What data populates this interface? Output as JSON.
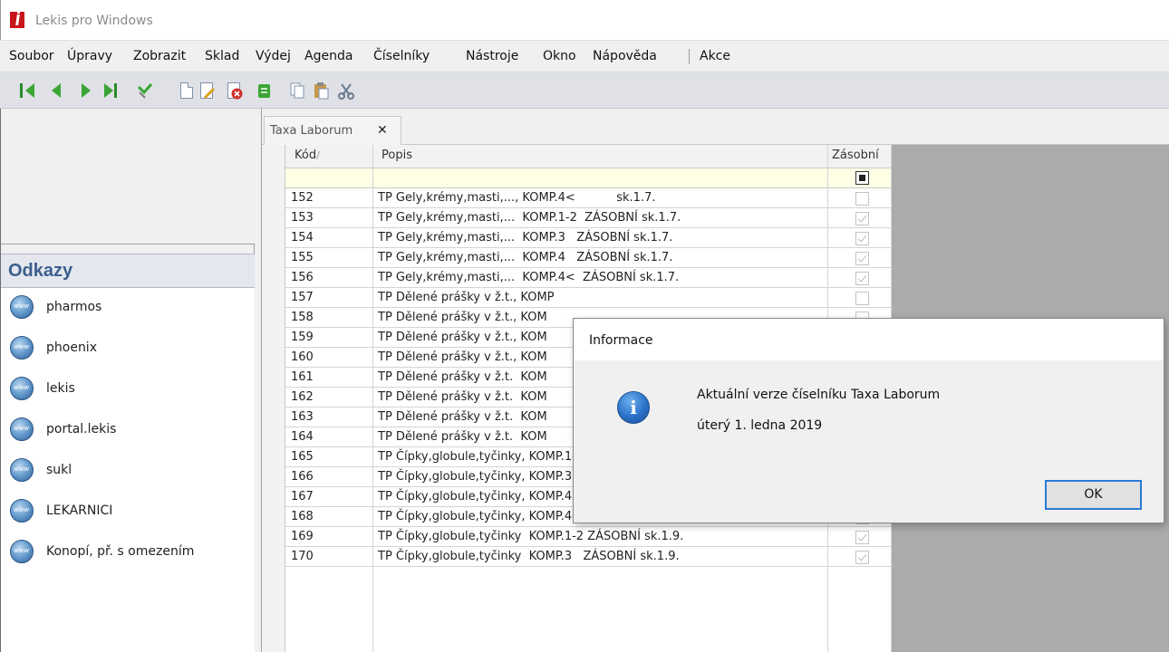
{
  "window": {
    "title": "Lekis pro Windows"
  },
  "menu": [
    "Soubor",
    "Úpravy",
    "Zobrazit",
    "Sklad",
    "Výdej",
    "Agenda",
    "Číselníky",
    "Nástroje",
    "Okno",
    "Nápověda",
    "Akce"
  ],
  "toolbar": {
    "icons": [
      "first-record-icon",
      "previous-record-icon",
      "next-record-icon",
      "last-record-icon",
      "filter-icon",
      "new-document-icon",
      "edit-document-icon",
      "delete-document-icon",
      "refresh-icon",
      "copy-icon",
      "paste-icon",
      "cut-icon"
    ]
  },
  "sidebar": {
    "links_title": "Odkazy",
    "links": [
      {
        "label": "pharmos",
        "icon": "globe-icon"
      },
      {
        "label": "phoenix",
        "icon": "globe-icon"
      },
      {
        "label": "lekis",
        "icon": "globe-icon"
      },
      {
        "label": "portal.lekis",
        "icon": "globe-icon"
      },
      {
        "label": "sukl",
        "icon": "globe-icon"
      },
      {
        "label": "LEKARNICI",
        "icon": "globe-icon"
      },
      {
        "label": "Konopí,  př. s omezením",
        "icon": "globe-icon"
      }
    ]
  },
  "tab": {
    "label": "Taxa Laborum",
    "close": "✕"
  },
  "grid": {
    "columns": {
      "kod": "Kód",
      "sort_marker": "/",
      "popis": "Popis",
      "zasobni": "Zásobní"
    },
    "rows": [
      {
        "kod": "152",
        "popis": "TP Gely,krémy,masti,..., KOMP.4<           sk.1.7.",
        "checked": false
      },
      {
        "kod": "153",
        "popis": "TP Gely,krémy,masti,...  KOMP.1-2  ZÁSOBNÍ sk.1.7.",
        "checked": true
      },
      {
        "kod": "154",
        "popis": "TP Gely,krémy,masti,...  KOMP.3   ZÁSOBNÍ sk.1.7.",
        "checked": true
      },
      {
        "kod": "155",
        "popis": "TP Gely,krémy,masti,...  KOMP.4   ZÁSOBNÍ sk.1.7.",
        "checked": true
      },
      {
        "kod": "156",
        "popis": "TP Gely,krémy,masti,...  KOMP.4<  ZÁSOBNÍ sk.1.7.",
        "checked": true
      },
      {
        "kod": "157",
        "popis": "TP Dělené prášky v ž.t., KOMP",
        "checked": false
      },
      {
        "kod": "158",
        "popis": "TP Dělené prášky v ž.t., KOM",
        "checked": false
      },
      {
        "kod": "159",
        "popis": "TP Dělené prášky v ž.t., KOM",
        "checked": false
      },
      {
        "kod": "160",
        "popis": "TP Dělené prášky v ž.t., KOM",
        "checked": false
      },
      {
        "kod": "161",
        "popis": "TP Dělené prášky v ž.t.  KOM",
        "checked": false
      },
      {
        "kod": "162",
        "popis": "TP Dělené prášky v ž.t.  KOM",
        "checked": false
      },
      {
        "kod": "163",
        "popis": "TP Dělené prášky v ž.t.  KOM",
        "checked": false
      },
      {
        "kod": "164",
        "popis": "TP Dělené prášky v ž.t.  KOM",
        "checked": false
      },
      {
        "kod": "165",
        "popis": "TP Čípky,globule,tyčinky, KOMP.1-2          sk.1.9.",
        "checked": false
      },
      {
        "kod": "166",
        "popis": "TP Čípky,globule,tyčinky, KOMP.3           sk.1.9.",
        "checked": false
      },
      {
        "kod": "167",
        "popis": "TP Čípky,globule,tyčinky, KOMP.4           sk.1.9.",
        "checked": false
      },
      {
        "kod": "168",
        "popis": "TP Čípky,globule,tyčinky, KOMP.4<           sk.1.9.",
        "checked": false
      },
      {
        "kod": "169",
        "popis": "TP Čípky,globule,tyčinky  KOMP.1-2 ZÁSOBNÍ sk.1.9.",
        "checked": true
      },
      {
        "kod": "170",
        "popis": "TP Čípky,globule,tyčinky  KOMP.3   ZÁSOBNÍ sk.1.9.",
        "checked": true
      }
    ]
  },
  "dialog": {
    "title": "Informace",
    "message": "Aktuální verze číselníku Taxa Laborum",
    "date": "úterý 1. ledna 2019",
    "ok_label": "OK",
    "icon": "info-icon"
  },
  "colors": {
    "links_header": "#3b5e8c",
    "accent": "#2b7ad6",
    "filter_row": "#ffffe6",
    "nav_green": "#3aa534"
  }
}
